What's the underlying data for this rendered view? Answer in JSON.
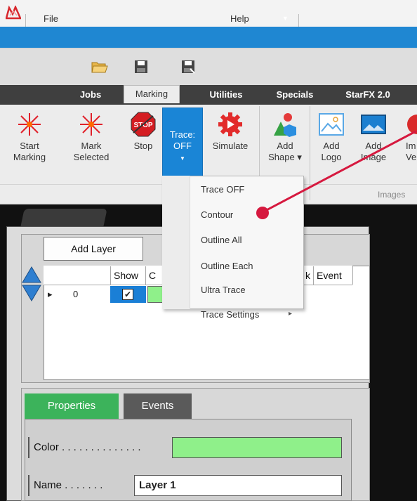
{
  "quick_toolbar": {
    "file_label": "File",
    "help_label": "Help"
  },
  "ribbon_tabs": [
    "Jobs",
    "Marking",
    "Utilities",
    "Specials",
    "StarFX 2.0"
  ],
  "ribbon_buttons": {
    "start_marking": [
      "Start",
      "Marking"
    ],
    "mark_selected": [
      "Mark",
      "Selected"
    ],
    "stop": "Stop",
    "trace": [
      "Trace:",
      "OFF"
    ],
    "simulate": "Simulate",
    "add_shape": [
      "Add",
      "Shape ▾"
    ],
    "add_logo": [
      "Add",
      "Logo"
    ],
    "add_image": [
      "Add",
      "Image"
    ],
    "cut_label": [
      "Im",
      "Ve"
    ]
  },
  "group_label": "Images",
  "trace_menu": {
    "items": [
      "Trace OFF",
      "Contour",
      "Outline All",
      "Outline Each",
      "Ultra Trace",
      "Trace Settings"
    ],
    "submenu_arrow": "▸"
  },
  "layer_panel": {
    "add_layer_label": "Add Layer",
    "columns": [
      "Show",
      "C",
      "k",
      "Event"
    ],
    "rows": [
      {
        "pointer": "▸",
        "index": "0",
        "show": "✔"
      }
    ]
  },
  "properties_panel": {
    "tabs": [
      "Properties",
      "Events"
    ],
    "color_label": "Color . . . . . . . . . . . . . .",
    "name_label": "Name . . . . . . .",
    "name_value": "Layer 1",
    "color_value": "#8ff08a"
  },
  "colors": {
    "accent_blue": "#1f87d2",
    "pressed_button": "#1a85d6",
    "annotation_red": "#d6193f",
    "tab_properties": "#3cb35b",
    "tab_events": "#5a5a5a"
  }
}
